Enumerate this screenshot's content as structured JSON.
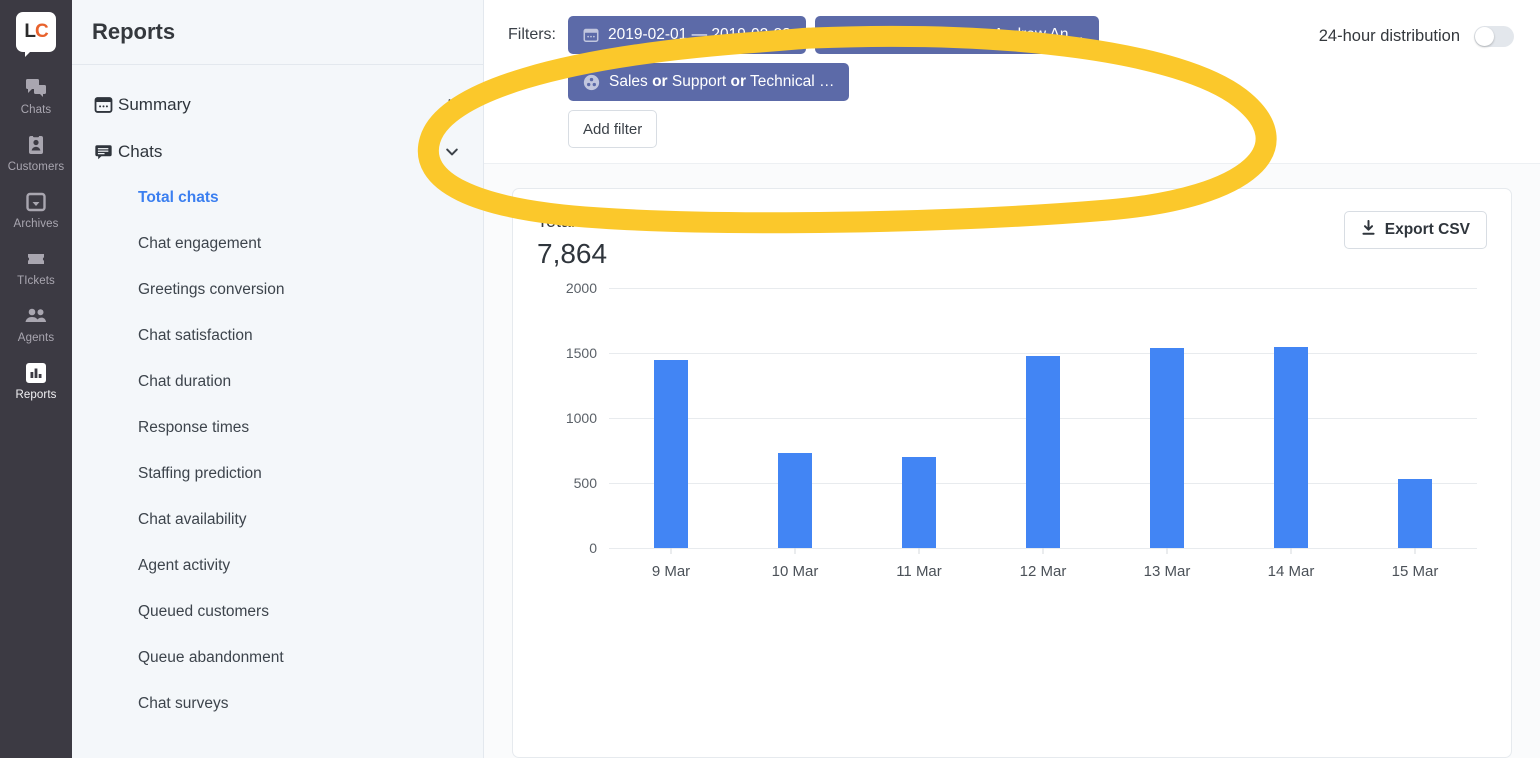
{
  "rail": {
    "logo": {
      "first": "L",
      "second": "C"
    },
    "items": [
      {
        "label": "Chats",
        "icon": "chats-icon"
      },
      {
        "label": "Customers",
        "icon": "customers-icon"
      },
      {
        "label": "Archives",
        "icon": "archives-icon"
      },
      {
        "label": "TIckets",
        "icon": "tickets-icon"
      },
      {
        "label": "Agents",
        "icon": "agents-icon"
      },
      {
        "label": "Reports",
        "icon": "reports-icon"
      }
    ],
    "active": "Reports"
  },
  "panel": {
    "title": "Reports",
    "groups": [
      {
        "label": "Summary",
        "icon": "calendar-icon",
        "chevron": "chevron-right-icon",
        "expanded": false
      },
      {
        "label": "Chats",
        "icon": "chat-bubble-icon",
        "chevron": "chevron-down-icon",
        "expanded": true
      }
    ],
    "chat_items": [
      {
        "label": "Total chats",
        "selected": true
      },
      {
        "label": "Chat engagement",
        "selected": false
      },
      {
        "label": "Greetings conversion",
        "selected": false
      },
      {
        "label": "Chat satisfaction",
        "selected": false
      },
      {
        "label": "Chat duration",
        "selected": false
      },
      {
        "label": "Response times",
        "selected": false
      },
      {
        "label": "Staffing prediction",
        "selected": false
      },
      {
        "label": "Chat availability",
        "selected": false
      },
      {
        "label": "Agent activity",
        "selected": false
      },
      {
        "label": "Queued customers",
        "selected": false
      },
      {
        "label": "Queue abandonment",
        "selected": false
      },
      {
        "label": "Chat surveys",
        "selected": false
      }
    ]
  },
  "filters": {
    "label": "Filters:",
    "pills": [
      {
        "icon": "calendar-icon",
        "text": "2019-02-01 — 2019-02-28",
        "name": "filter-pill-date-range"
      },
      {
        "icon": "agent-avatar-icon",
        "text_parts": [
          "Jane Janeowsky ",
          "or",
          " Andrew An…"
        ],
        "name": "filter-pill-agents"
      },
      {
        "icon": "group-icon",
        "text_parts": [
          "Sales ",
          "or",
          " Support ",
          "or",
          " Technical …"
        ],
        "name": "filter-pill-groups"
      }
    ],
    "add_filter_label": "Add filter",
    "distribution_label": "24-hour distribution",
    "distribution_on": false
  },
  "card": {
    "title": "Total chats",
    "info_icon": "info-icon",
    "value": "7,864",
    "export_label": "Export CSV",
    "export_icon": "download-icon"
  },
  "chart_data": {
    "type": "bar",
    "title": "Total chats",
    "categories": [
      "9 Mar",
      "10 Mar",
      "11 Mar",
      "12 Mar",
      "13 Mar",
      "14 Mar",
      "15 Mar"
    ],
    "values": [
      1450,
      730,
      700,
      1480,
      1540,
      1550,
      530
    ],
    "yticks": [
      0,
      500,
      1000,
      1500,
      2000
    ],
    "ylim": [
      0,
      2000
    ],
    "xlabel": "",
    "ylabel": "",
    "grid": true,
    "legend": "none",
    "bar_color": "#4285f4",
    "total": "7,864"
  },
  "annotation": {
    "shape": "hand-drawn-ellipse",
    "color": "#fbc82b"
  },
  "colors": {
    "pill": "#5c6aa8",
    "accent": "#3b7ff0",
    "bar": "#4285f4",
    "rail": "#3c3a43",
    "panel": "#f4f7fa"
  }
}
